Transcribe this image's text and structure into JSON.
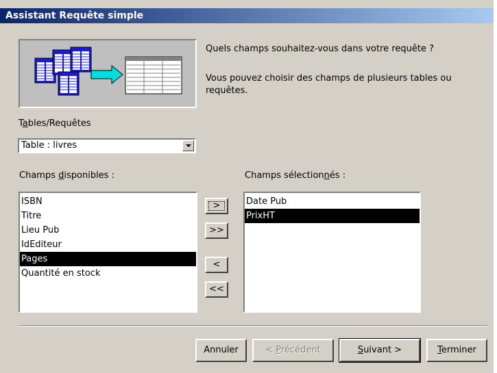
{
  "window": {
    "title": "Assistant Requête simple"
  },
  "intro": {
    "question": "Quels champs souhaitez-vous dans votre requête ?",
    "hint": "Vous pouvez choisir des champs de plusieurs tables ou requêtes."
  },
  "tables": {
    "label_pre": "T",
    "label_accel": "a",
    "label_post": "bles/Requêtes",
    "value": "Table : livres"
  },
  "available": {
    "label_pre": "Champs ",
    "label_accel": "d",
    "label_post": "isponibles :",
    "items": [
      "ISBN",
      "Titre",
      "Lieu Pub",
      "IdEditeur",
      "Pages",
      "Quantité en stock"
    ],
    "selected_index": 4
  },
  "selected": {
    "label_pre": "Champs sélection",
    "label_accel": "n",
    "label_post": "és :",
    "items": [
      "Date Pub",
      "PrixHT"
    ],
    "selected_index": 1
  },
  "move": {
    "add_one": ">",
    "add_all": ">>",
    "remove_one": "<",
    "remove_all": "<<"
  },
  "footer": {
    "cancel": "Annuler",
    "back_pre": "< ",
    "back_accel": "P",
    "back_post": "récédent",
    "next_accel": "S",
    "next_post": "uivant >",
    "finish_accel": "T",
    "finish_post": "erminer"
  },
  "colors": {
    "dialog_bg": "#d4d0c8",
    "title_start": "#0a246a",
    "title_end": "#a6caf0",
    "selection": "#000000"
  },
  "icons": [
    "tables-to-query-illustration",
    "dropdown-arrow-icon"
  ]
}
